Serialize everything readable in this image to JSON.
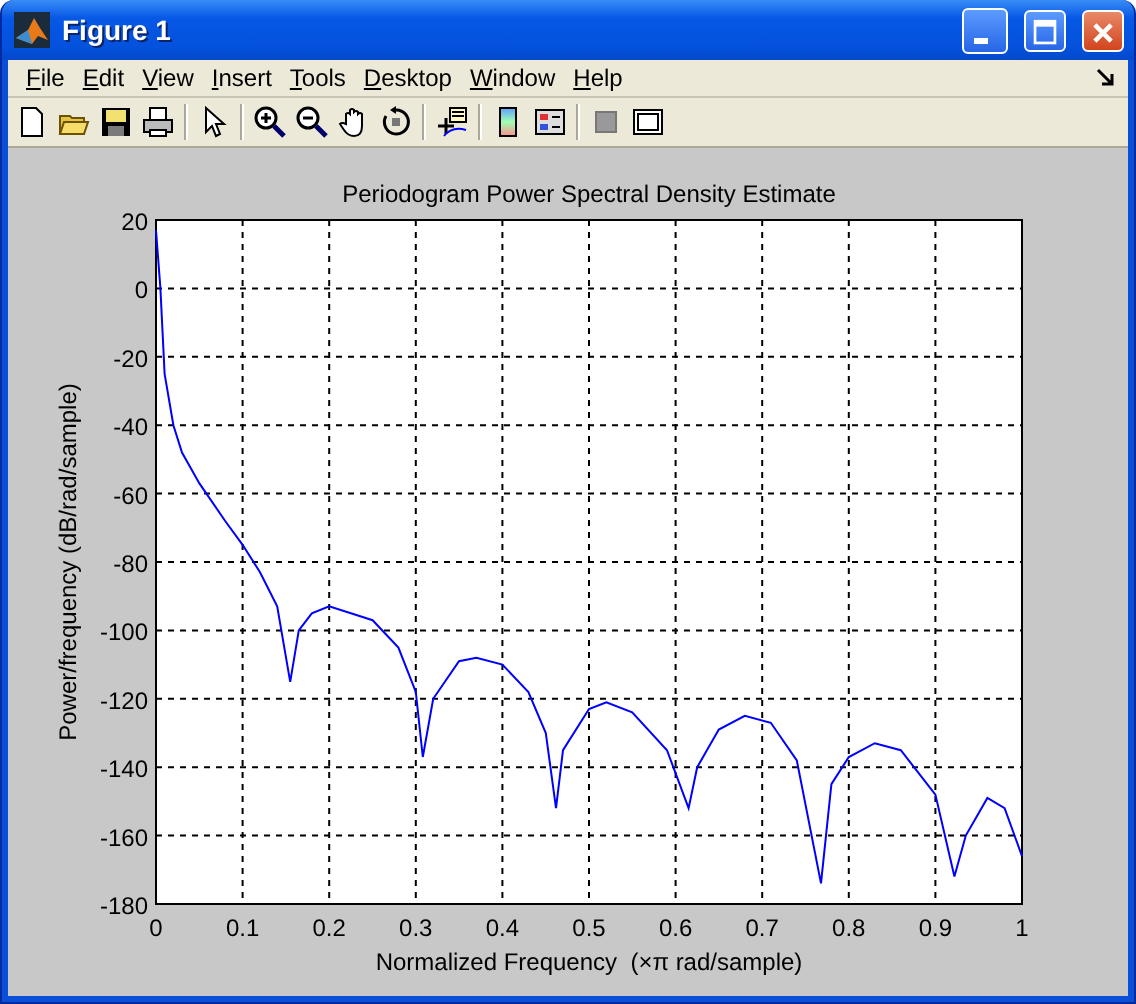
{
  "window": {
    "title": "Figure 1"
  },
  "menu": [
    {
      "label": "File"
    },
    {
      "label": "Edit"
    },
    {
      "label": "View"
    },
    {
      "label": "Insert"
    },
    {
      "label": "Tools"
    },
    {
      "label": "Desktop"
    },
    {
      "label": "Window"
    },
    {
      "label": "Help"
    }
  ],
  "figure": {
    "chart_data": {
      "type": "line",
      "title": "Periodogram Power Spectral Density Estimate",
      "xlabel": "Normalized Frequency  (×π rad/sample)",
      "ylabel": "Power/frequency (dB/rad/sample)",
      "x": [
        0,
        0.005,
        0.01,
        0.02,
        0.03,
        0.05,
        0.08,
        0.1,
        0.12,
        0.14,
        0.155,
        0.165,
        0.18,
        0.2,
        0.25,
        0.28,
        0.3,
        0.308,
        0.32,
        0.35,
        0.37,
        0.4,
        0.43,
        0.45,
        0.462,
        0.47,
        0.5,
        0.52,
        0.55,
        0.59,
        0.615,
        0.625,
        0.65,
        0.68,
        0.71,
        0.74,
        0.768,
        0.78,
        0.8,
        0.83,
        0.86,
        0.9,
        0.922,
        0.935,
        0.96,
        0.98,
        1.0
      ],
      "series": [
        {
          "color": "#0000ff",
          "values": [
            17,
            0,
            -25,
            -40,
            -48,
            -57,
            -68,
            -75,
            -83,
            -93,
            -115,
            -100,
            -95,
            -93,
            -97,
            -105,
            -118,
            -137,
            -120,
            -109,
            -108,
            -110,
            -118,
            -130,
            -152,
            -135,
            -123,
            -121,
            -124,
            -135,
            -152,
            -140,
            -129,
            -125,
            -127,
            -138,
            -174,
            -145,
            -137,
            -133,
            -135,
            -148,
            -172,
            -160,
            -149,
            -152,
            -166
          ]
        }
      ],
      "grid": true,
      "xlim": [
        0,
        1
      ],
      "ylim": [
        -180,
        20
      ],
      "xticks": [
        0,
        0.1,
        0.2,
        0.3,
        0.4,
        0.5,
        0.6,
        0.7,
        0.8,
        0.9,
        1
      ],
      "yticks": [
        20,
        0,
        -20,
        -40,
        -60,
        -80,
        -100,
        -120,
        -140,
        -160,
        -180
      ]
    }
  }
}
